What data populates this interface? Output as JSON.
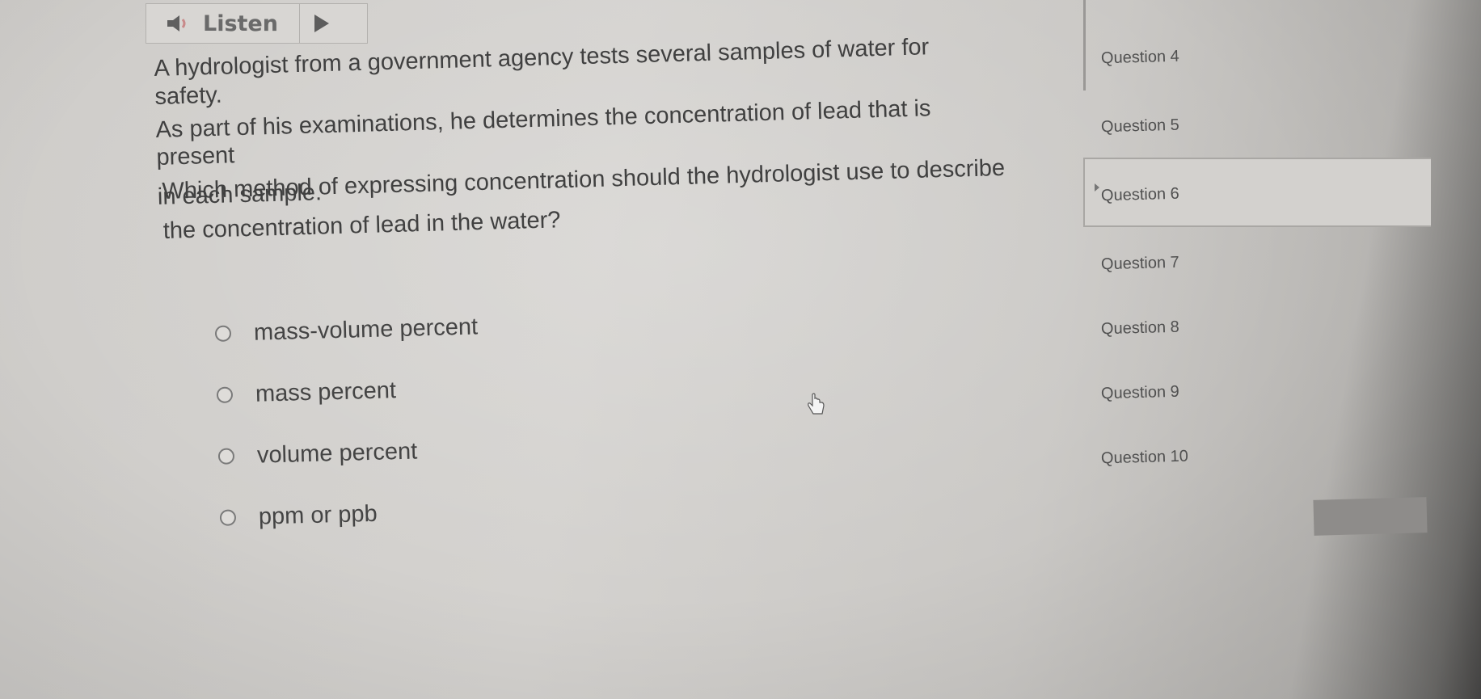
{
  "toolbar": {
    "listen_label": "Listen",
    "speaker_icon": "speaker-icon",
    "play_icon": "play-icon"
  },
  "question": {
    "paragraph_lines": [
      "A hydrologist from a government agency tests several samples of water for safety.",
      "As part of his examinations, he determines the concentration of lead that is present",
      "in each sample."
    ],
    "prompt_lines": [
      "Which method of expressing concentration should the hydrologist use to describe",
      "the concentration of lead in the water?"
    ]
  },
  "options": [
    {
      "label": "mass-volume percent"
    },
    {
      "label": "mass percent"
    },
    {
      "label": "volume percent"
    },
    {
      "label": "ppm or ppb"
    }
  ],
  "sidebar": {
    "items": [
      {
        "label": "Question 4"
      },
      {
        "label": "Question 5"
      },
      {
        "label": "Question 6",
        "active": true
      },
      {
        "label": "Question 7"
      },
      {
        "label": "Question 8"
      },
      {
        "label": "Question 9"
      },
      {
        "label": "Question 10"
      }
    ]
  },
  "colors": {
    "background": "#d4d2cf",
    "text": "#404040",
    "accent_border": "#a9a7a4"
  }
}
